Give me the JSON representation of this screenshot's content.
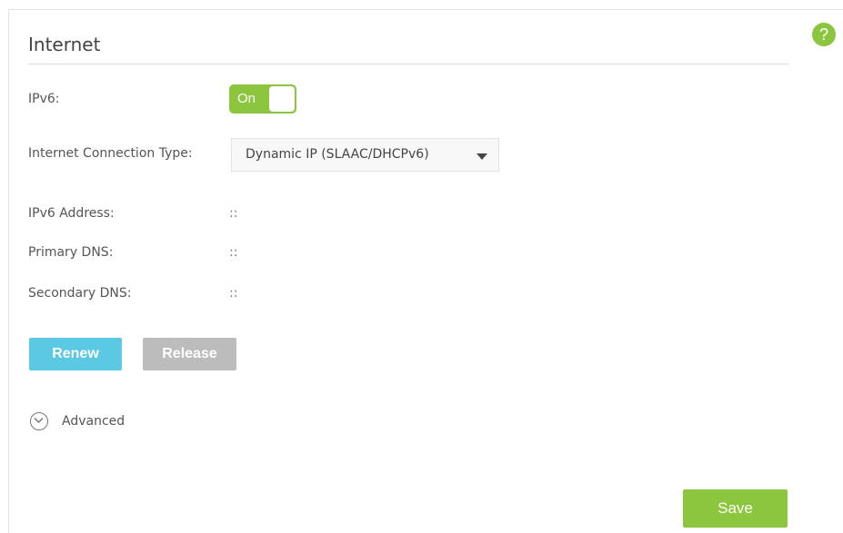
{
  "section": {
    "title": "Internet"
  },
  "help": {
    "icon": "help-icon",
    "glyph": "?"
  },
  "ipv6": {
    "label": "IPv6:",
    "toggle_state": "On"
  },
  "connection": {
    "label": "Internet Connection Type:",
    "selected": "Dynamic IP (SLAAC/DHCPv6)"
  },
  "info": {
    "address_label": "IPv6 Address:",
    "address_value": "::",
    "primary_dns_label": "Primary DNS:",
    "primary_dns_value": "::",
    "secondary_dns_label": "Secondary DNS:",
    "secondary_dns_value": "::"
  },
  "actions": {
    "renew": "Renew",
    "release": "Release",
    "save": "Save"
  },
  "advanced": {
    "label": "Advanced"
  },
  "colors": {
    "accent_green": "#8cc63f",
    "renew_blue": "#5bc8e4",
    "disabled_gray": "#bcbcbc"
  }
}
